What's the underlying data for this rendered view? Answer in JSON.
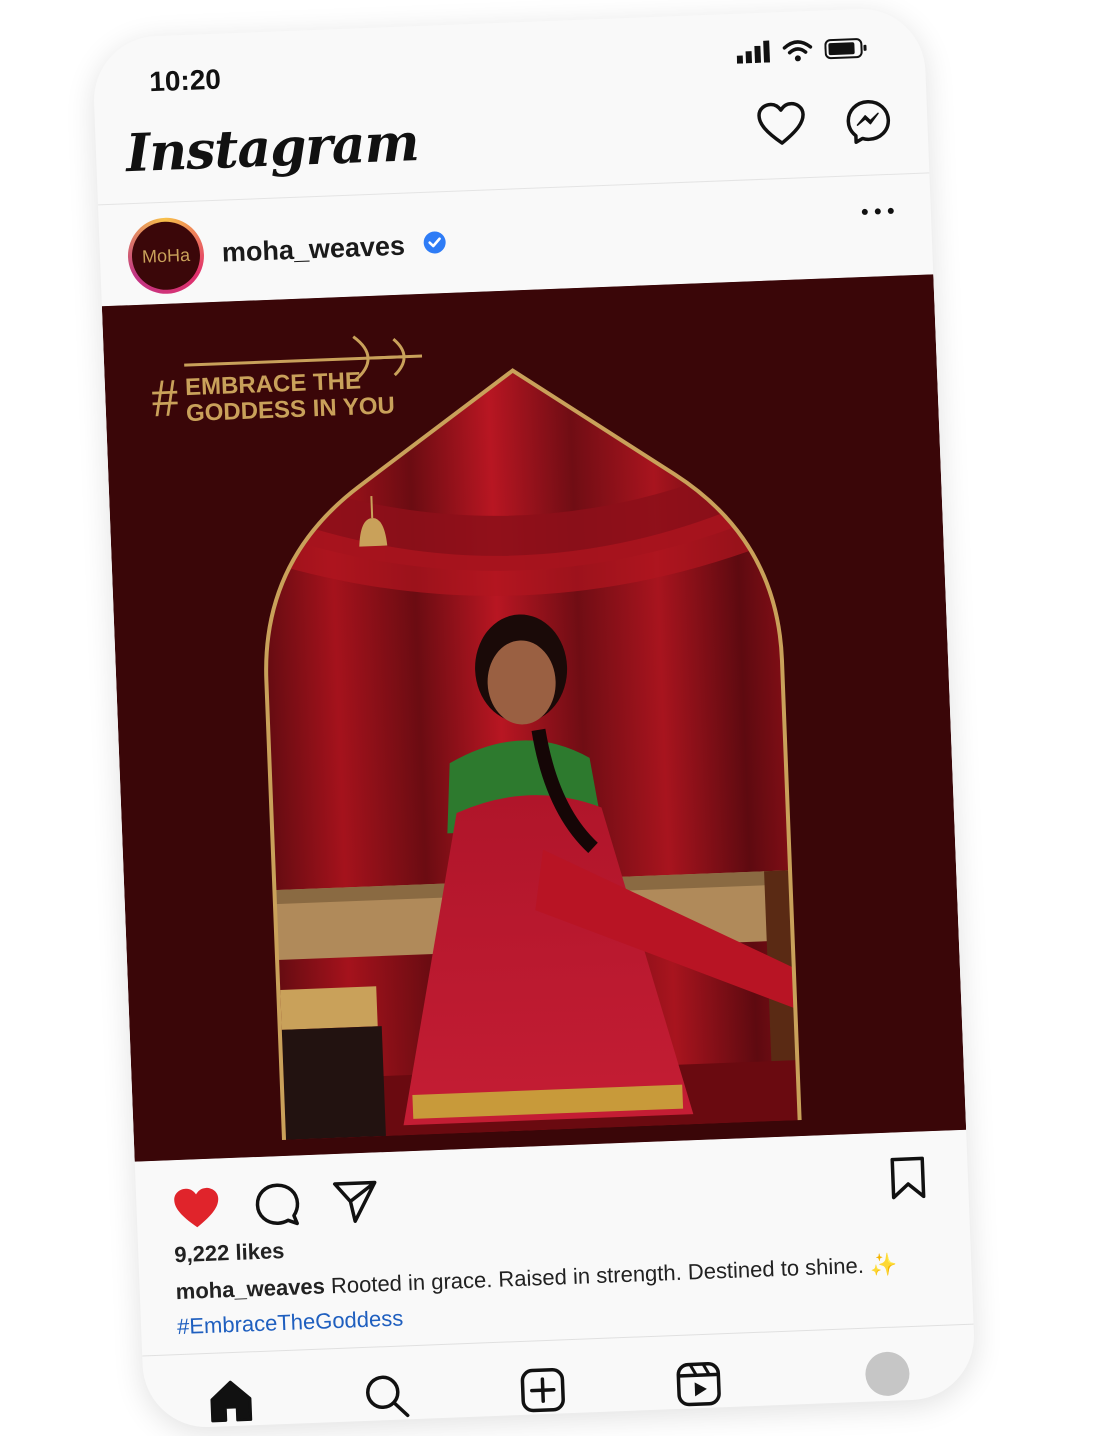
{
  "status": {
    "time": "10:20"
  },
  "header": {
    "logo": "Instagram",
    "icons": [
      "heart-icon",
      "messenger-icon"
    ]
  },
  "post": {
    "username": "moha_weaves",
    "avatar_text": "MoHa",
    "verified": true,
    "image": {
      "overlay_hash": "#",
      "overlay_line1": "EMBRACE THE",
      "overlay_line2": "GODDESS IN YOU"
    },
    "likes": "9,222 likes",
    "caption_user": "moha_weaves",
    "caption_text": "Rooted in grace. Raised in strength. Destined to shine.",
    "caption_emoji": "✨",
    "hashtag": "#EmbraceTheGoddess"
  },
  "colors": {
    "like_red": "#e0242b",
    "hashtag_blue": "#1f5fbf",
    "image_bg": "#3a0608",
    "gold": "#c9a15a"
  },
  "nav": [
    "home-icon",
    "search-icon",
    "create-icon",
    "reels-icon",
    "profile-avatar"
  ]
}
